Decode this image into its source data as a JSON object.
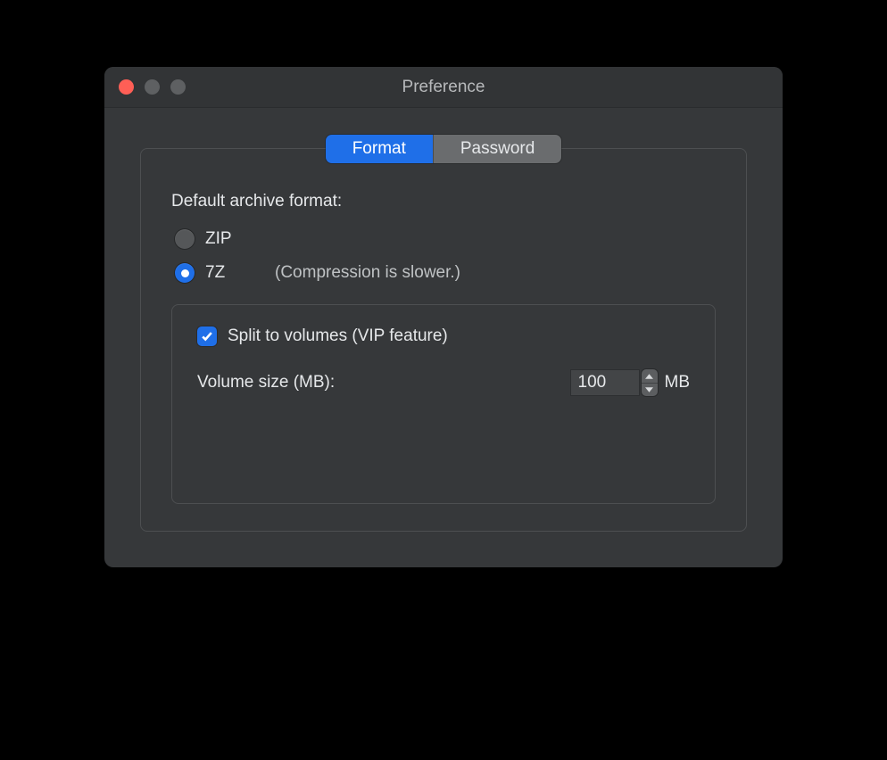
{
  "window": {
    "title": "Preference"
  },
  "tabs": {
    "format": "Format",
    "password": "Password",
    "active": "format"
  },
  "format": {
    "section_label": "Default archive format:",
    "options": {
      "zip": {
        "label": "ZIP",
        "hint": ""
      },
      "sevenz": {
        "label": "7Z",
        "hint": "(Compression is slower.)"
      }
    },
    "selected": "sevenz",
    "split": {
      "checked": true,
      "label": "Split to volumes (VIP feature)",
      "size_label": "Volume size (MB):",
      "value": "100",
      "unit": "MB"
    }
  }
}
